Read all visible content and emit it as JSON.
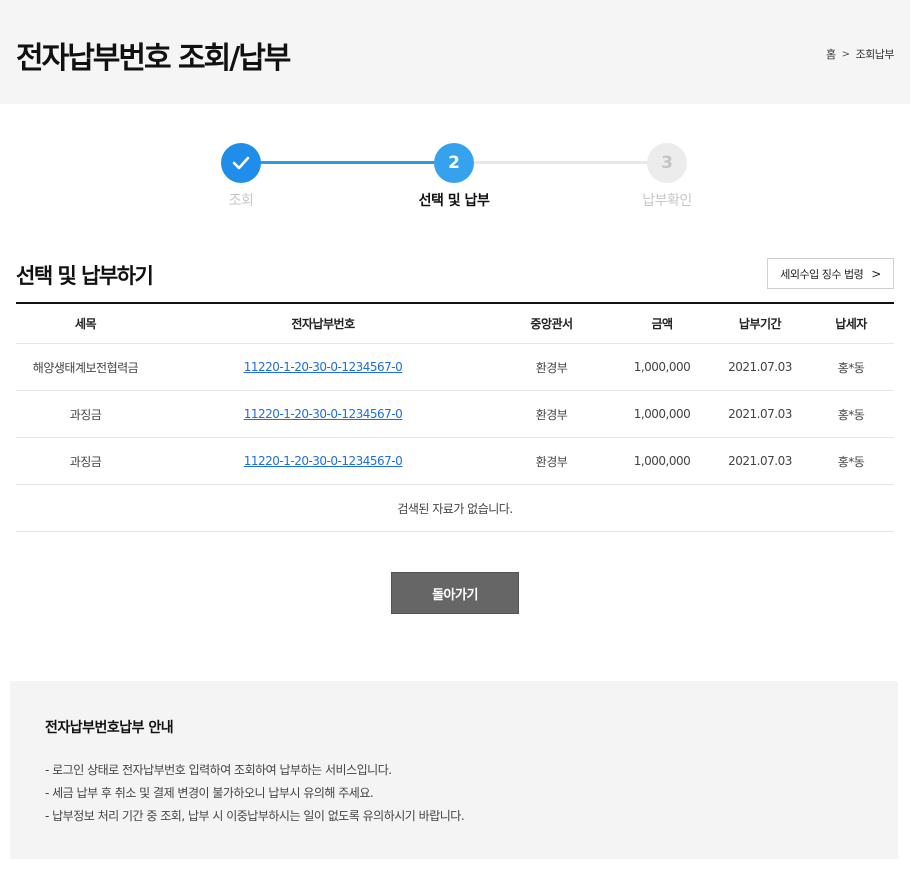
{
  "header": {
    "title": "전자납부번호 조회/납부",
    "breadcrumb": {
      "home": "홈",
      "separator": ">",
      "current": "조회납부"
    }
  },
  "stepper": {
    "steps": [
      {
        "label": "조회",
        "marker": "✓",
        "state": "done"
      },
      {
        "label": "선택 및 납부",
        "marker": "2",
        "state": "active"
      },
      {
        "label": "납부확인",
        "marker": "3",
        "state": "pending"
      }
    ]
  },
  "section": {
    "title": "선택 및 납부하기",
    "law_button_label": "세외수입 징수 법령",
    "law_button_chevron": ">"
  },
  "table": {
    "columns": [
      "세목",
      "전자납부번호",
      "중앙관서",
      "금액",
      "납부기간",
      "납세자"
    ],
    "rows": [
      {
        "tax_item": "해양생태계보전협력금",
        "payment_no": "11220-1-20-30-0-1234567-0",
        "agency": "환경부",
        "amount": "1,000,000",
        "period": "2021.07.03",
        "taxpayer": "홍*동"
      },
      {
        "tax_item": "과징금",
        "payment_no": "11220-1-20-30-0-1234567-0",
        "agency": "환경부",
        "amount": "1,000,000",
        "period": "2021.07.03",
        "taxpayer": "홍*동"
      },
      {
        "tax_item": "과징금",
        "payment_no": "11220-1-20-30-0-1234567-0",
        "agency": "환경부",
        "amount": "1,000,000",
        "period": "2021.07.03",
        "taxpayer": "홍*동"
      }
    ],
    "empty_message": "검색된 자료가 없습니다."
  },
  "back_button_label": "돌아가기",
  "guide": {
    "title": "전자납부번호납부 안내",
    "items": [
      "- 로그인 상태로 전자납부번호 입력하여 조회하여 납부하는 서비스입니다.",
      "- 세금 납부 후 취소 및 결제 변경이 불가하오니 납부시 유의해 주세요.",
      "- 납부정보 처리 기간 중 조회, 납부 시 이중납부하시는 일이 없도록 유의하시기 바랍니다."
    ]
  },
  "colors": {
    "step_done": "#1f8eea",
    "step_active": "#36a2ee",
    "step_pending": "#ececec",
    "link": "#1e6fd9",
    "back_button": "#666666",
    "header_bg": "#f5f5f6"
  },
  "icons": {
    "step_done": "check-icon",
    "law_button": "chevron-right-icon",
    "breadcrumb_sep": "chevron-right-icon"
  }
}
